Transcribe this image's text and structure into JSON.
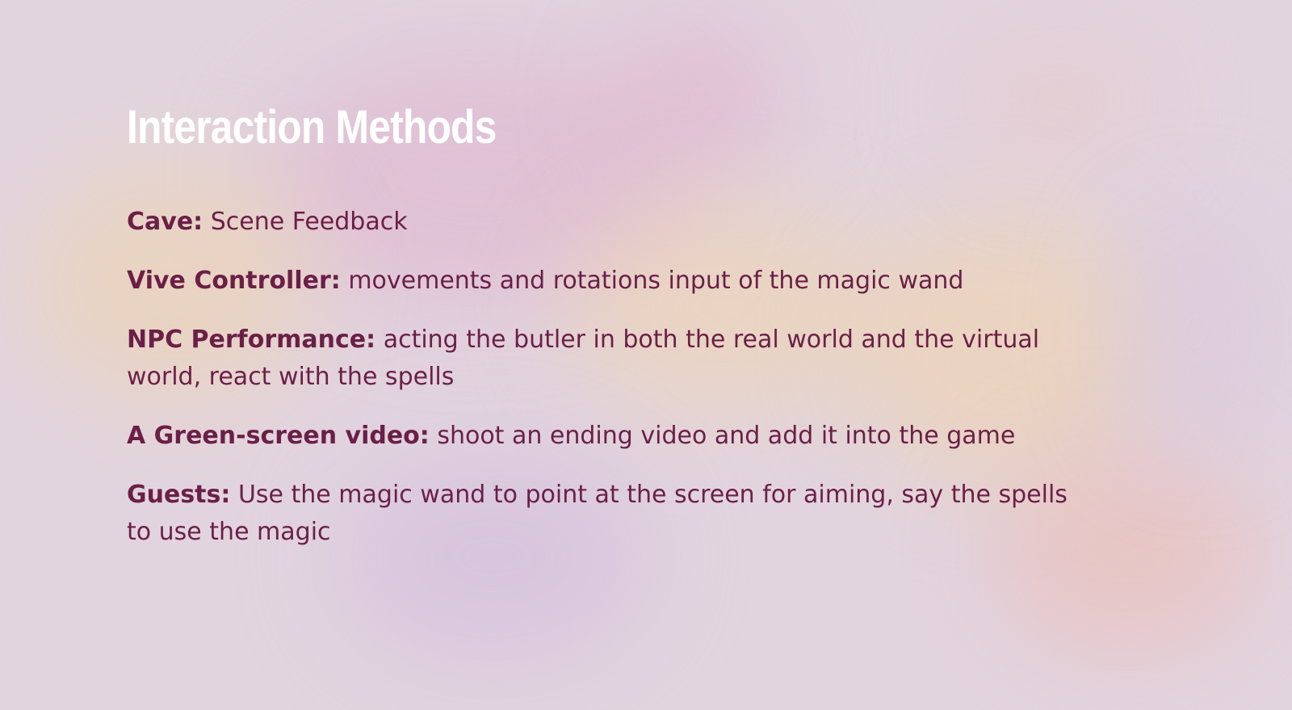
{
  "slide": {
    "title": "Interaction Methods",
    "items": [
      {
        "label": "Cave:",
        "text": "Scene Feedback"
      },
      {
        "label": "Vive Controller:",
        "text": "movements and rotations input of the magic wand"
      },
      {
        "label": "NPC Performance:",
        "text": "acting the butler in both the real world and the virtual world, react with the spells"
      },
      {
        "label": "A Green-screen video:",
        "text": "shoot an ending video and add it into the game"
      },
      {
        "label": "Guests:",
        "text": "Use the magic wand to point at the screen for aiming, say the spells to use the magic"
      }
    ]
  },
  "colors": {
    "background": "#e2d4df",
    "title": "#ffffff",
    "body_text": "#6b1f47"
  }
}
